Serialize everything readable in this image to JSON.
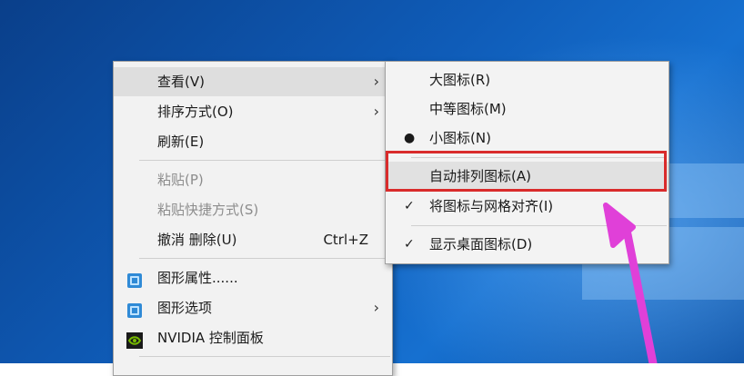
{
  "main_menu": {
    "items": [
      {
        "label": "查看(V)",
        "arrow": "›"
      },
      {
        "label": "排序方式(O)",
        "arrow": "›"
      },
      {
        "label": "刷新(E)"
      },
      {
        "label": "粘贴(P)"
      },
      {
        "label": "粘贴快捷方式(S)"
      },
      {
        "label": "撤消 删除(U)",
        "accel": "Ctrl+Z"
      },
      {
        "label": "图形属性......"
      },
      {
        "label": "图形选项",
        "arrow": "›"
      },
      {
        "label": "NVIDIA 控制面板"
      }
    ]
  },
  "sub_menu": {
    "items": [
      {
        "label": "大图标(R)"
      },
      {
        "label": "中等图标(M)"
      },
      {
        "label": "小图标(N)",
        "mark": "●"
      },
      {
        "label": "自动排列图标(A)"
      },
      {
        "label": "将图标与网格对齐(I)",
        "mark": "✓"
      },
      {
        "label": "显示桌面图标(D)",
        "mark": "✓"
      }
    ]
  },
  "colors": {
    "highlight_border": "#d92b2b",
    "annotation_arrow": "#e040d8"
  }
}
